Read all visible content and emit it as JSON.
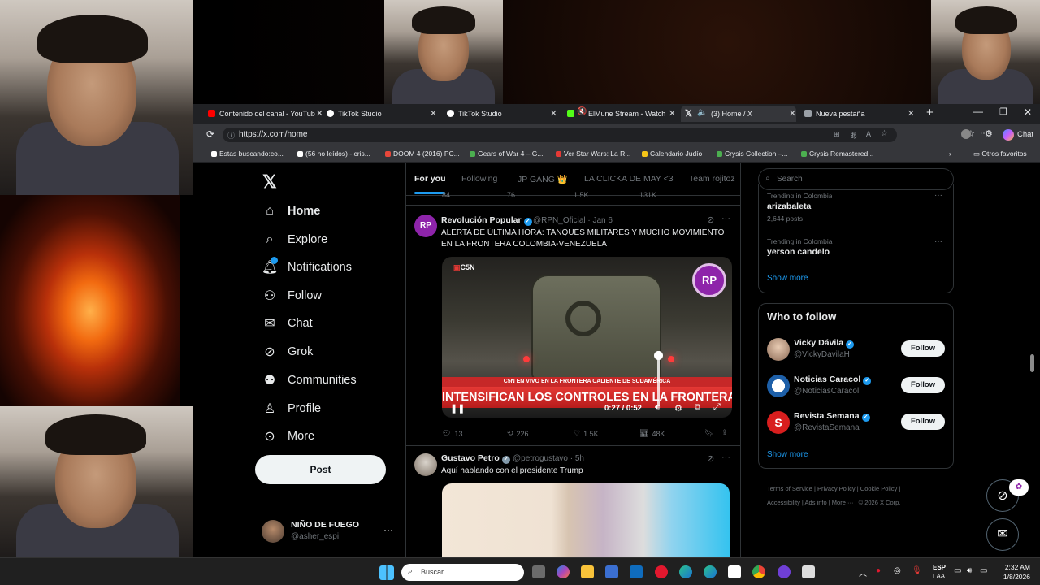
{
  "browser": {
    "tabs": [
      {
        "label": "Contenido del canal - YouTub",
        "icon": "youtube-icon",
        "color": "#ff0000"
      },
      {
        "label": "TikTok Studio",
        "icon": "tiktok-icon",
        "color": "#ffffff"
      },
      {
        "label": "TikTok Studio",
        "icon": "tiktok-icon",
        "color": "#ffffff"
      },
      {
        "label": "ElMune Stream - Watch",
        "icon": "kick-icon",
        "color": "#53fc18"
      },
      {
        "label": "(3) Home / X",
        "icon": "x-icon",
        "color": "#ffffff"
      },
      {
        "label": "Nueva pestaña",
        "icon": "newtab-icon",
        "color": "#9aa0a6"
      }
    ],
    "url": "https://x.com/home",
    "chat_label": "Chat",
    "bookmarks": [
      {
        "label": "Estas buscando:co...",
        "color": "#ffffff"
      },
      {
        "label": "(56 no leídos) - cris...",
        "color": "#ffffff"
      },
      {
        "label": "DOOM 4 (2016) PC...",
        "color": "#e8473a"
      },
      {
        "label": "Gears of War 4 – G...",
        "color": "#4caf50"
      },
      {
        "label": "Ver Star Wars: La R...",
        "color": "#e53935"
      },
      {
        "label": "Calendario Judío",
        "color": "#f5c518"
      },
      {
        "label": "Crysis Collection –...",
        "color": "#4caf50"
      },
      {
        "label": "Crysis Remastered...",
        "color": "#4caf50"
      }
    ],
    "other_bookmarks": "Otros favoritos"
  },
  "nav": {
    "items": [
      "Home",
      "Explore",
      "Notifications",
      "Follow",
      "Chat",
      "Grok",
      "Communities",
      "Profile",
      "More"
    ],
    "post_label": "Post",
    "account_name": "NIÑO DE FUEGO",
    "account_handle": "@asher_espi"
  },
  "feed": {
    "tabs": [
      "For you",
      "Following",
      "JP GANG 👑",
      "LA CLICKA DE MAY <3",
      "Team rojitoz"
    ],
    "prev_stats": {
      "replies": "84",
      "reposts": "76",
      "likes": "1.5K",
      "views": "131K"
    },
    "post1": {
      "name": "Revolución Popular",
      "handle": "@RPN_Oficial · Jan 6",
      "text": "ALERTA DE ÚLTIMA HORA: TANQUES MILITARES Y MUCHO MOVIMIENTO EN LA FRONTERA COLOMBIA-VENEZUELA",
      "avatar_text": "RP",
      "video": {
        "brand": "C5N",
        "badge": "RP",
        "ticker": "C5N EN VIVO EN LA FRONTERA CALIENTE DE SUDAMÉRICA",
        "headline": "INTENSIFICAN LOS CONTROLES EN LA FRONTERA",
        "time": "0:27 / 0:52"
      },
      "stats": {
        "replies": "13",
        "reposts": "226",
        "likes": "1.5K",
        "views": "48K"
      }
    },
    "post2": {
      "name": "Gustavo Petro",
      "handle": "@petrogustavo · 5h",
      "text": "Aquí hablando con el presidente Trump"
    }
  },
  "right": {
    "search_placeholder": "Search",
    "trends": [
      {
        "context": "Trending in Colombia",
        "name": "arizabaleta",
        "posts": "2,644 posts"
      },
      {
        "context": "Trending in Colombia",
        "name": "yerson candelo",
        "posts": ""
      }
    ],
    "show_more": "Show more",
    "who_title": "Who to follow",
    "suggestions": [
      {
        "name": "Vicky Dávila",
        "handle": "@VickyDavilaH",
        "color": "#c9a58a"
      },
      {
        "name": "Noticias Caracol",
        "handle": "@NoticiasCaracol",
        "color": "#1d5fa8"
      },
      {
        "name": "Revista Semana",
        "handle": "@RevistaSemana",
        "color": "#d81e1e"
      }
    ],
    "follow_label": "Follow",
    "footer": [
      "Terms of Service",
      "Privacy Policy",
      "Cookie Policy",
      "Accessibility",
      "Ads info",
      "More ···",
      "© 2026 X Corp."
    ]
  },
  "taskbar": {
    "search_placeholder": "Buscar",
    "lang": "ESP",
    "lang2": "LAA",
    "time": "2:32 AM",
    "date": "1/8/2026"
  }
}
